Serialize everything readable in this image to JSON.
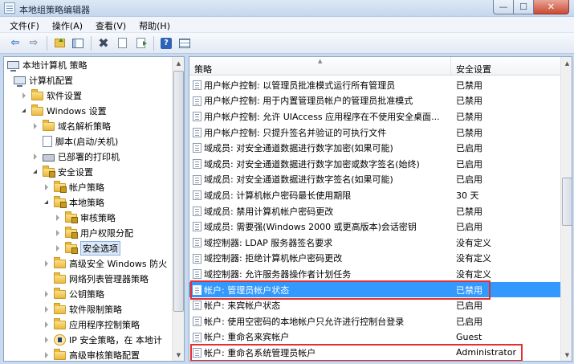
{
  "window": {
    "title": "本地组策略编辑器",
    "min_glyph": "—",
    "max_glyph": "☐",
    "close_glyph": "✕"
  },
  "menu": [
    "文件(F)",
    "操作(A)",
    "查看(V)",
    "帮助(H)"
  ],
  "toolbar": {
    "back_glyph": "⇦",
    "forward_glyph": "⇨",
    "delete_glyph": "✖",
    "help_glyph": "?"
  },
  "tree": {
    "items": [
      {
        "label": "本地计算机 策略",
        "icon": "computer-icon"
      },
      {
        "label": "计算机配置",
        "icon": "computer-icon"
      },
      {
        "label": "软件设置",
        "icon": "folder-icon"
      },
      {
        "label": "Windows 设置",
        "icon": "folder-icon"
      },
      {
        "label": "域名解析策略",
        "icon": "folder-icon"
      },
      {
        "label": "脚本(启动/关机)",
        "icon": "script-icon"
      },
      {
        "label": "已部署的打印机",
        "icon": "printer-icon"
      },
      {
        "label": "安全设置",
        "icon": "security-folder-icon"
      },
      {
        "label": "帐户策略",
        "icon": "folder-icon"
      },
      {
        "label": "本地策略",
        "icon": "folder-icon"
      },
      {
        "label": "审核策略",
        "icon": "folder-icon"
      },
      {
        "label": "用户权限分配",
        "icon": "folder-icon"
      },
      {
        "label": "安全选项",
        "icon": "folder-icon"
      },
      {
        "label": "高级安全 Windows 防火",
        "icon": "folder-icon"
      },
      {
        "label": "网络列表管理器策略",
        "icon": "folder-icon"
      },
      {
        "label": "公钥策略",
        "icon": "folder-icon"
      },
      {
        "label": "软件限制策略",
        "icon": "folder-icon"
      },
      {
        "label": "应用程序控制策略",
        "icon": "folder-icon"
      },
      {
        "label": "IP 安全策略，在 本地计",
        "icon": "ip-security-icon"
      },
      {
        "label": "高级审核策略配置",
        "icon": "folder-icon"
      }
    ],
    "selected_label": "安全选项"
  },
  "list": {
    "header": {
      "policy": "策略",
      "setting": "安全设置",
      "sort_glyph": "▲"
    },
    "rows": [
      {
        "policy": "用户帐户控制: 以管理员批准模式运行所有管理员",
        "setting": "已禁用"
      },
      {
        "policy": "用户帐户控制: 用于内置管理员帐户的管理员批准模式",
        "setting": "已禁用"
      },
      {
        "policy": "用户帐户控制: 允许 UIAccess 应用程序在不使用安全桌面...",
        "setting": "已禁用"
      },
      {
        "policy": "用户帐户控制: 只提升签名并验证的可执行文件",
        "setting": "已禁用"
      },
      {
        "policy": "域成员: 对安全通道数据进行数字加密(如果可能)",
        "setting": "已启用"
      },
      {
        "policy": "域成员: 对安全通道数据进行数字加密或数字签名(始终)",
        "setting": "已启用"
      },
      {
        "policy": "域成员: 对安全通道数据进行数字签名(如果可能)",
        "setting": "已启用"
      },
      {
        "policy": "域成员: 计算机帐户密码最长使用期限",
        "setting": "30 天"
      },
      {
        "policy": "域成员: 禁用计算机帐户密码更改",
        "setting": "已禁用"
      },
      {
        "policy": "域成员: 需要强(Windows 2000 或更高版本)会话密钥",
        "setting": "已启用"
      },
      {
        "policy": "域控制器: LDAP 服务器签名要求",
        "setting": "没有定义"
      },
      {
        "policy": "域控制器: 拒绝计算机帐户密码更改",
        "setting": "没有定义"
      },
      {
        "policy": "域控制器: 允许服务器操作者计划任务",
        "setting": "没有定义"
      },
      {
        "policy": "帐户: 管理员帐户状态",
        "setting": "已禁用"
      },
      {
        "policy": "帐户: 来宾帐户状态",
        "setting": "已启用"
      },
      {
        "policy": "帐户: 使用空密码的本地帐户只允许进行控制台登录",
        "setting": "已启用"
      },
      {
        "policy": "帐户: 重命名来宾帐户",
        "setting": "Guest"
      },
      {
        "policy": "帐户: 重命名系统管理员帐户",
        "setting": "Administrator"
      }
    ],
    "selected_policy": "帐户: 管理员帐户状态"
  },
  "colors": {
    "selection": "#3399ff",
    "highlight_box": "#e3302f"
  }
}
